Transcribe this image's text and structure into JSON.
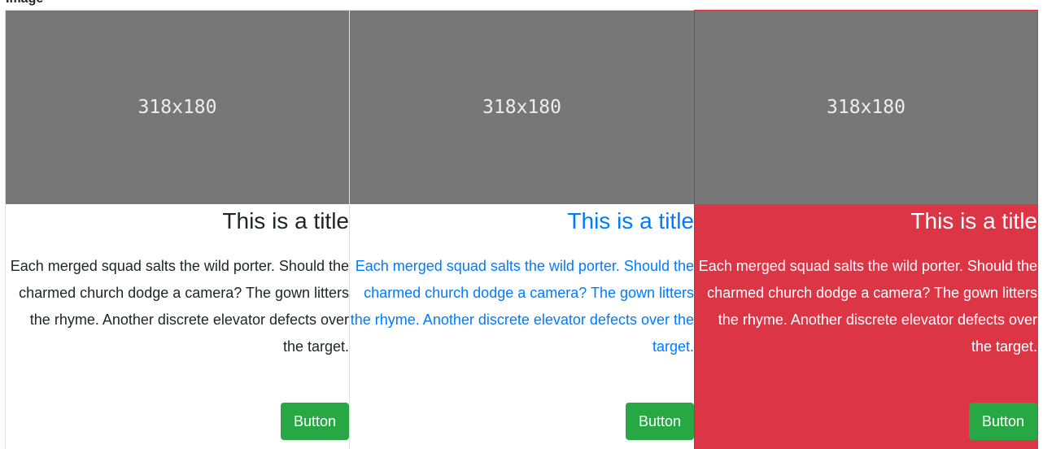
{
  "header": {
    "cutoff_title": "Image"
  },
  "cards": [
    {
      "image_label": "318x180",
      "title": "This is a title",
      "text": "Each merged squad salts the wild porter. Should the charmed church dodge a camera? The gown litters the rhyme. Another discrete elevator defects over the target.",
      "button_label": "Button"
    },
    {
      "image_label": "318x180",
      "title": "This is a title",
      "text": "Each merged squad salts the wild porter. Should the charmed church dodge a camera? The gown litters the rhyme. Another discrete elevator defects over the target.",
      "button_label": "Button"
    },
    {
      "image_label": "318x180",
      "title": "This is a title",
      "text": "Each merged squad salts the wild porter. Should the charmed church dodge a camera? The gown litters the rhyme. Another discrete elevator defects over the target.",
      "button_label": "Button"
    }
  ],
  "colors": {
    "placeholder_bg": "#777777",
    "placeholder_text": "#eceeef",
    "primary_blue": "#007bff",
    "danger_red": "#dc3545",
    "success_green": "#28a745",
    "dark_text": "#212529"
  }
}
